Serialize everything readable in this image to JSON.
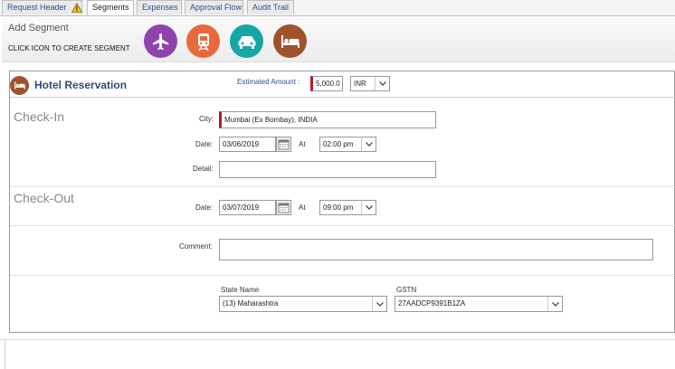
{
  "tabs": [
    {
      "label": "Request Header",
      "warning": true
    },
    {
      "label": "Segments",
      "active": true
    },
    {
      "label": "Expenses"
    },
    {
      "label": "Approval Flow"
    },
    {
      "label": "Audit Trail"
    }
  ],
  "add_segment": {
    "title": "Add Segment",
    "subtitle": "CLICK ICON TO CREATE SEGMENT",
    "icons": [
      {
        "name": "airplane-icon",
        "color": "#8e44ad"
      },
      {
        "name": "train-icon",
        "color": "#e8693c"
      },
      {
        "name": "car-icon",
        "color": "#16a6a6"
      },
      {
        "name": "bed-icon",
        "color": "#a0522d"
      }
    ]
  },
  "hotel": {
    "title": "Hotel Reservation",
    "estimated_label": "Estimated Amount :",
    "estimated_value": "5,000.0",
    "currency": "INR"
  },
  "checkin": {
    "title": "Check-In",
    "city_label": "City:",
    "city_value": "Mumbai (Ex Bombay), INDIA",
    "date_label": "Date:",
    "date_value": "03/06/2019",
    "at_label": "At",
    "time_value": "02:00 pm",
    "detail_label": "Detail:",
    "detail_value": ""
  },
  "checkout": {
    "title": "Check-Out",
    "date_label": "Date:",
    "date_value": "03/07/2019",
    "at_label": "At",
    "time_value": "09:00 pm"
  },
  "comment": {
    "label": "Comment:",
    "value": ""
  },
  "gst": {
    "state_label": "State Name",
    "state_value": "(13) Maharashtra",
    "gstn_label": "GSTN",
    "gstn_value": "27AADCP9391B1ZA"
  }
}
